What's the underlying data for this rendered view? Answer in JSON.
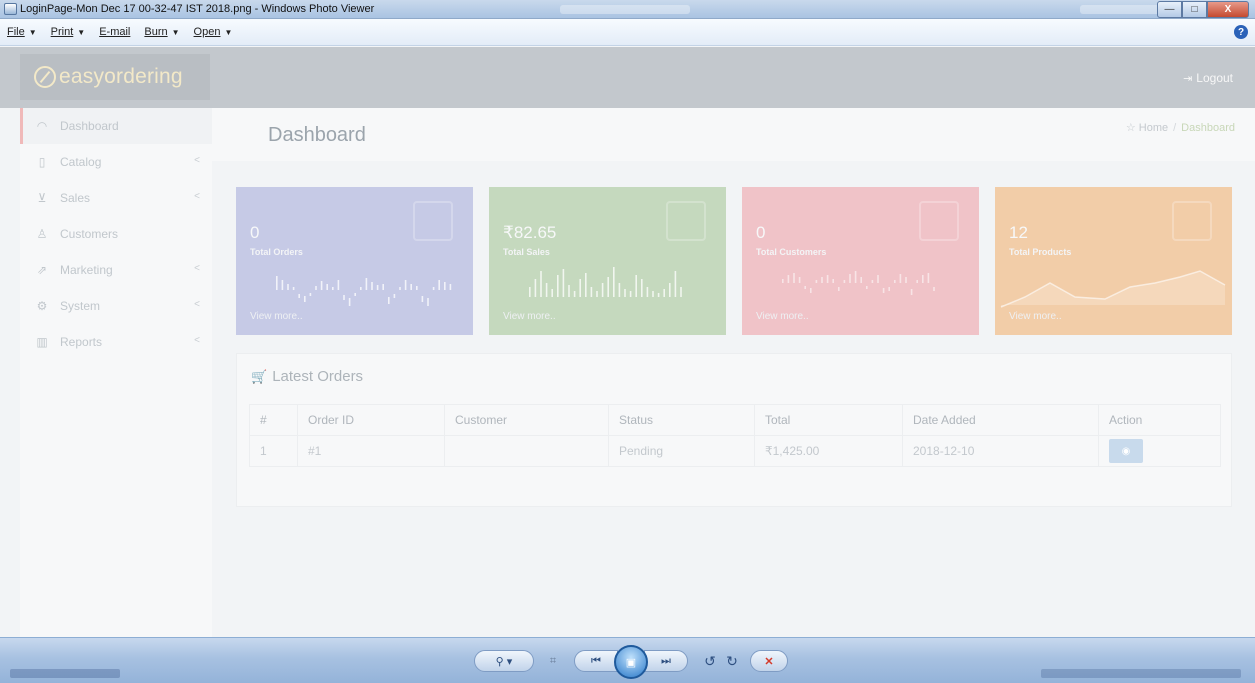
{
  "window": {
    "title": "LoginPage-Mon Dec 17 00-32-47 IST 2018.png - Windows Photo Viewer",
    "minimize_label": "—",
    "maximize_label": "□",
    "close_label": "X"
  },
  "menu": {
    "file": "File",
    "print": "Print",
    "email": "E-mail",
    "burn": "Burn",
    "open": "Open",
    "help_icon": "?"
  },
  "web": {
    "logo_text": "easyordering",
    "logout_label": "Logout",
    "sidebar": {
      "items": [
        {
          "label": "Dashboard",
          "icon": "dashboard-icon",
          "glyph": "◠"
        },
        {
          "label": "Catalog",
          "icon": "tag-icon",
          "glyph": "▯"
        },
        {
          "label": "Sales",
          "icon": "cart-icon",
          "glyph": "⊻"
        },
        {
          "label": "Customers",
          "icon": "user-icon",
          "glyph": "♙"
        },
        {
          "label": "Marketing",
          "icon": "share-icon",
          "glyph": "⇗"
        },
        {
          "label": "System",
          "icon": "gear-icon",
          "glyph": "⚙"
        },
        {
          "label": "Reports",
          "icon": "bar-chart-icon",
          "glyph": "▥"
        }
      ],
      "chevron": "<"
    },
    "page_title": "Dashboard",
    "breadcrumb": {
      "home": "Home",
      "separator": "/",
      "current": "Dashboard"
    },
    "tiles": [
      {
        "value": "0",
        "label": "Total Orders",
        "more": "View more..",
        "color": "#c6cae6"
      },
      {
        "value": "₹82.65",
        "label": "Total Sales",
        "more": "View more..",
        "color": "#c5d9be"
      },
      {
        "value": "0",
        "label": "Total Customers",
        "more": "View more..",
        "color": "#f0c3c8"
      },
      {
        "value": "12",
        "label": "Total Products",
        "more": "View more..",
        "color": "#f2cda8"
      }
    ],
    "latest_orders": {
      "title": "Latest Orders",
      "columns": [
        "#",
        "Order ID",
        "Customer",
        "Status",
        "Total",
        "Date Added",
        "Action"
      ],
      "rows": [
        {
          "num": "1",
          "order_id": "#1",
          "customer": "",
          "status": "Pending",
          "total": "₹1,425.00",
          "date": "2018-12-10"
        }
      ]
    }
  },
  "toolbar": {
    "zoom": "⚲ ▾",
    "fit": "⌗",
    "prev": "⏮",
    "play": "▣",
    "next": "⏭",
    "rotate_left": "↺",
    "rotate_right": "↻",
    "delete": "✕"
  }
}
